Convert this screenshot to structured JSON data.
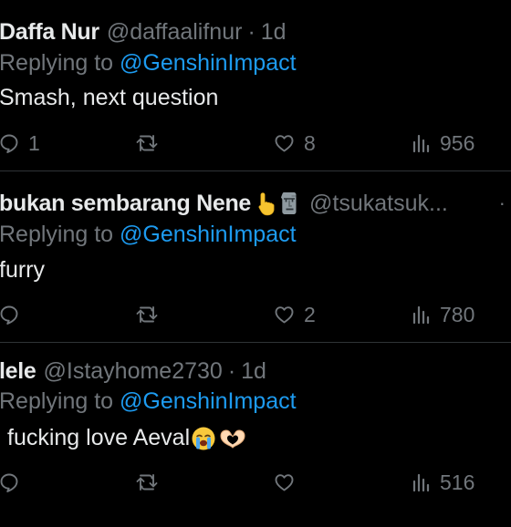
{
  "replies": [
    {
      "name": "Daffa Nur",
      "handle": "@daffaalifnur",
      "dot": "·",
      "time": "1d",
      "replying_prefix": "Replying to",
      "replying_to": "@GenshinImpact",
      "text": "Smash, next question",
      "replies": "1",
      "retweets": "",
      "likes": "8",
      "views": "956"
    },
    {
      "name": "bukan sembarang Nene",
      "name_emojis": [
        "index-pointing-up-emoji",
        "moai-emoji"
      ],
      "handle": "@tsukatsuk...",
      "more": "·",
      "replying_prefix": "Replying to",
      "replying_to": "@GenshinImpact",
      "text": "furry",
      "replies": "",
      "retweets": "",
      "likes": "2",
      "views": "780"
    },
    {
      "name": "lele",
      "handle": "@Istayhome2730",
      "dot": "·",
      "time": "1d",
      "replying_prefix": "Replying to",
      "replying_to": "@GenshinImpact",
      "text": "fucking love Aeval",
      "text_emojis": [
        "loudly-crying-face-emoji",
        "heart-hands-emoji"
      ],
      "replies": "",
      "retweets": "",
      "likes": "",
      "views": "516"
    }
  ],
  "colors": {
    "background": "#000000",
    "text": "#e7e9ea",
    "secondary": "#71767b",
    "mention": "#1d9bf0",
    "divider": "#2f3336"
  }
}
